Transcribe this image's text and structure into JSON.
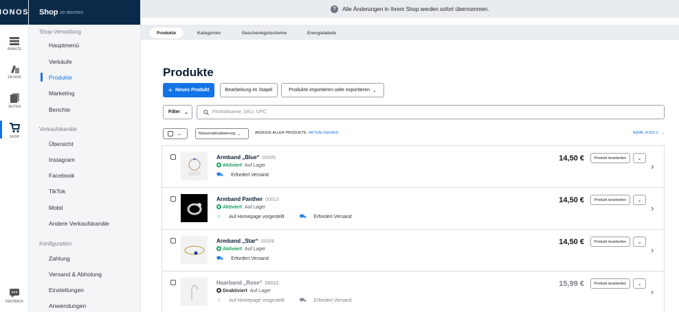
{
  "brand": {
    "logo": "IONOS"
  },
  "rail": {
    "items": [
      {
        "label": "INHALTE",
        "icon": "content-icon"
      },
      {
        "label": "DESIGN",
        "icon": "design-icon"
      },
      {
        "label": "SEITEN",
        "icon": "pages-icon"
      },
      {
        "label": "SHOP",
        "icon": "cart-icon"
      },
      {
        "label": "FEEDBACK",
        "icon": "chat-icon"
      }
    ]
  },
  "shop": {
    "name": "Shop",
    "id": "(ID: 89137257)"
  },
  "sidebar": {
    "sections": [
      {
        "title": "Shop-Verwaltung",
        "items": [
          "Hauptmenü",
          "Verkäufe",
          "Produkte",
          "Marketing",
          "Berichte"
        ]
      },
      {
        "title": "Verkaufskanäle",
        "items": [
          "Übersicht",
          "Instagram",
          "Facebook",
          "TikTok",
          "Mobil",
          "Andere Verkaufskanäle"
        ]
      },
      {
        "title": "Konfiguration",
        "items": [
          "Zahlung",
          "Versand & Abholung",
          "Einstellungen",
          "Anwendungen"
        ]
      }
    ],
    "active": "Produkte"
  },
  "banner": {
    "text": "Alle Änderungen in Ihrem Shop werden sofort übernommen."
  },
  "tabs": [
    "Produkte",
    "Kategorien",
    "Geschenkgutscheine",
    "Energielabels"
  ],
  "page": {
    "title": "Produkte",
    "new_product": "Neues Produkt",
    "bulk_edit": "Bearbeitung im Stapel",
    "import_export": "Produkte importieren oder exportieren"
  },
  "filter": {
    "label": "Filter",
    "search_placeholder": "Produktname, SKU, UPC"
  },
  "listbar": {
    "mass_update": "Massenaktualisierung",
    "show_all": "ANZEIGE ALLER PRODUKTE",
    "refresh": "AKTUALISIEREN",
    "sort": "NAME: A BIS Z"
  },
  "products": [
    {
      "name": "Armband „Blue“",
      "sku": "00005",
      "status": "Aktiviert",
      "stock": "Auf Lager",
      "tags": [
        "Erfordert Versand"
      ],
      "price": "14,50 €",
      "edit": "Produkt bearbeiten"
    },
    {
      "name": "Armband Panther",
      "sku": "00013",
      "status": "Aktiviert",
      "stock": "Auf Lager",
      "tags": [
        "Auf Homepage vorgestellt",
        "Erfordert Versand"
      ],
      "price": "14,50 €",
      "edit": "Produkt bearbeiten"
    },
    {
      "name": "Armband „Star“",
      "sku": "00006",
      "status": "Aktiviert",
      "stock": "Auf Lager",
      "tags": [
        "Erfordert Versand"
      ],
      "price": "14,50 €",
      "edit": "Produkt bearbeiten"
    },
    {
      "name": "Haarband „Rose“",
      "sku": "00010",
      "status": "Deaktiviert",
      "stock": "Auf Lager",
      "tags": [
        "Auf Homepage vorgestellt",
        "Erfordert Versand"
      ],
      "price": "15,99 €",
      "edit": "Produkt bearbeiten"
    }
  ],
  "colors": {
    "brand_navy": "#0b2a4a",
    "accent_blue": "#1474e6",
    "active_green": "#13a15a"
  }
}
